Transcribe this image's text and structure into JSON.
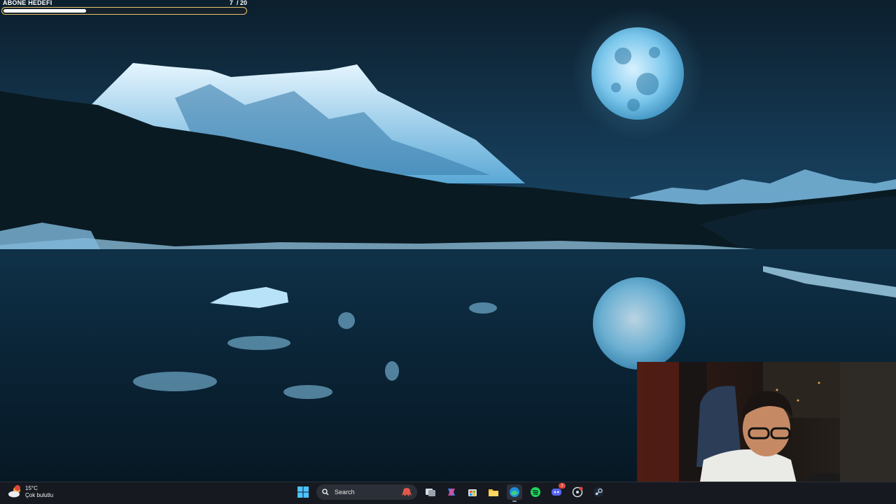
{
  "goal": {
    "title": "ABONE HEDEFİ",
    "current": "7",
    "separator": "/",
    "target": "20",
    "progress": 0.35
  },
  "weather": {
    "temperature": "15°C",
    "condition": "Çok bulutlu",
    "icon": "partly-cloudy-icon"
  },
  "taskbar": {
    "search_placeholder": "Search",
    "apps": [
      {
        "name": "task-view",
        "icon": "task-view-icon"
      },
      {
        "name": "copilot",
        "icon": "copilot-icon"
      },
      {
        "name": "microsoft-store",
        "icon": "store-icon"
      },
      {
        "name": "file-explorer",
        "icon": "folder-icon"
      },
      {
        "name": "edge",
        "icon": "edge-icon"
      },
      {
        "name": "spotify",
        "icon": "spotify-icon"
      },
      {
        "name": "discord",
        "icon": "discord-icon",
        "badge": "1"
      },
      {
        "name": "chrome-app",
        "icon": "app-icon"
      },
      {
        "name": "steam",
        "icon": "steam-icon"
      }
    ]
  },
  "colors": {
    "accent": "#e9c56b",
    "taskbar": "#161a20",
    "sky": "#0b1e2c",
    "water": "#0a2435"
  }
}
